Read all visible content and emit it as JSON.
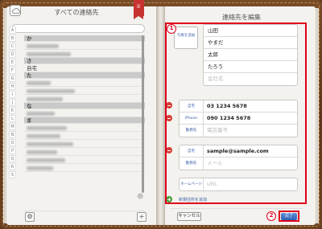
{
  "left": {
    "title": "すべての連絡先",
    "ribbon_icon": "contacts-bookmark-icon",
    "index_letters": [
      "A",
      "B",
      "C",
      "D",
      "E",
      "F",
      "G",
      "H",
      "I",
      "J",
      "K",
      "L",
      "M",
      "N",
      "O",
      "P",
      "Q",
      "R",
      "S"
    ],
    "rows": [
      {
        "type": "header",
        "text": "か"
      },
      {
        "type": "blur",
        "text": ""
      },
      {
        "type": "blur",
        "text": ""
      },
      {
        "type": "header",
        "text": "さ"
      },
      {
        "type": "text",
        "text": "自宅"
      },
      {
        "type": "header",
        "text": "た"
      },
      {
        "type": "blur",
        "text": ""
      },
      {
        "type": "blur",
        "text": ""
      },
      {
        "type": "blur",
        "text": ""
      },
      {
        "type": "header",
        "text": "な"
      },
      {
        "type": "blur",
        "text": ""
      },
      {
        "type": "header",
        "text": "ま"
      },
      {
        "type": "blur",
        "text": ""
      },
      {
        "type": "blur",
        "text": ""
      },
      {
        "type": "blur",
        "text": ""
      },
      {
        "type": "blur",
        "text": ""
      },
      {
        "type": "blur",
        "text": ""
      },
      {
        "type": "blur",
        "text": ""
      }
    ]
  },
  "right": {
    "title": "連絡先を編集",
    "photo_button": "写真を追加",
    "name_fields": [
      "山田",
      "やまだ",
      "太郎",
      "たろう",
      "会社名"
    ],
    "phone_group": [
      {
        "label": "自宅",
        "value": "03 1234 5678",
        "placeholder": false
      },
      {
        "label": "iPhone",
        "value": "090 1234 5678",
        "placeholder": false
      },
      {
        "label": "勤務先",
        "value": "電話番号",
        "placeholder": true
      }
    ],
    "email_group": [
      {
        "label": "自宅",
        "value": "sample@sample.com",
        "placeholder": false
      },
      {
        "label": "勤務先",
        "value": "メール",
        "placeholder": true
      }
    ],
    "url_group": [
      {
        "label": "ホームページ",
        "value": "URL",
        "placeholder": true
      }
    ],
    "add_field": "新規住所を追加",
    "cancel": "キャンセル",
    "done": "完了"
  },
  "annotations": {
    "one": "1",
    "two": "2"
  },
  "colors": {
    "highlight": "#e0001b",
    "link": "#3a5fa8",
    "done": "#2d5fb2"
  }
}
